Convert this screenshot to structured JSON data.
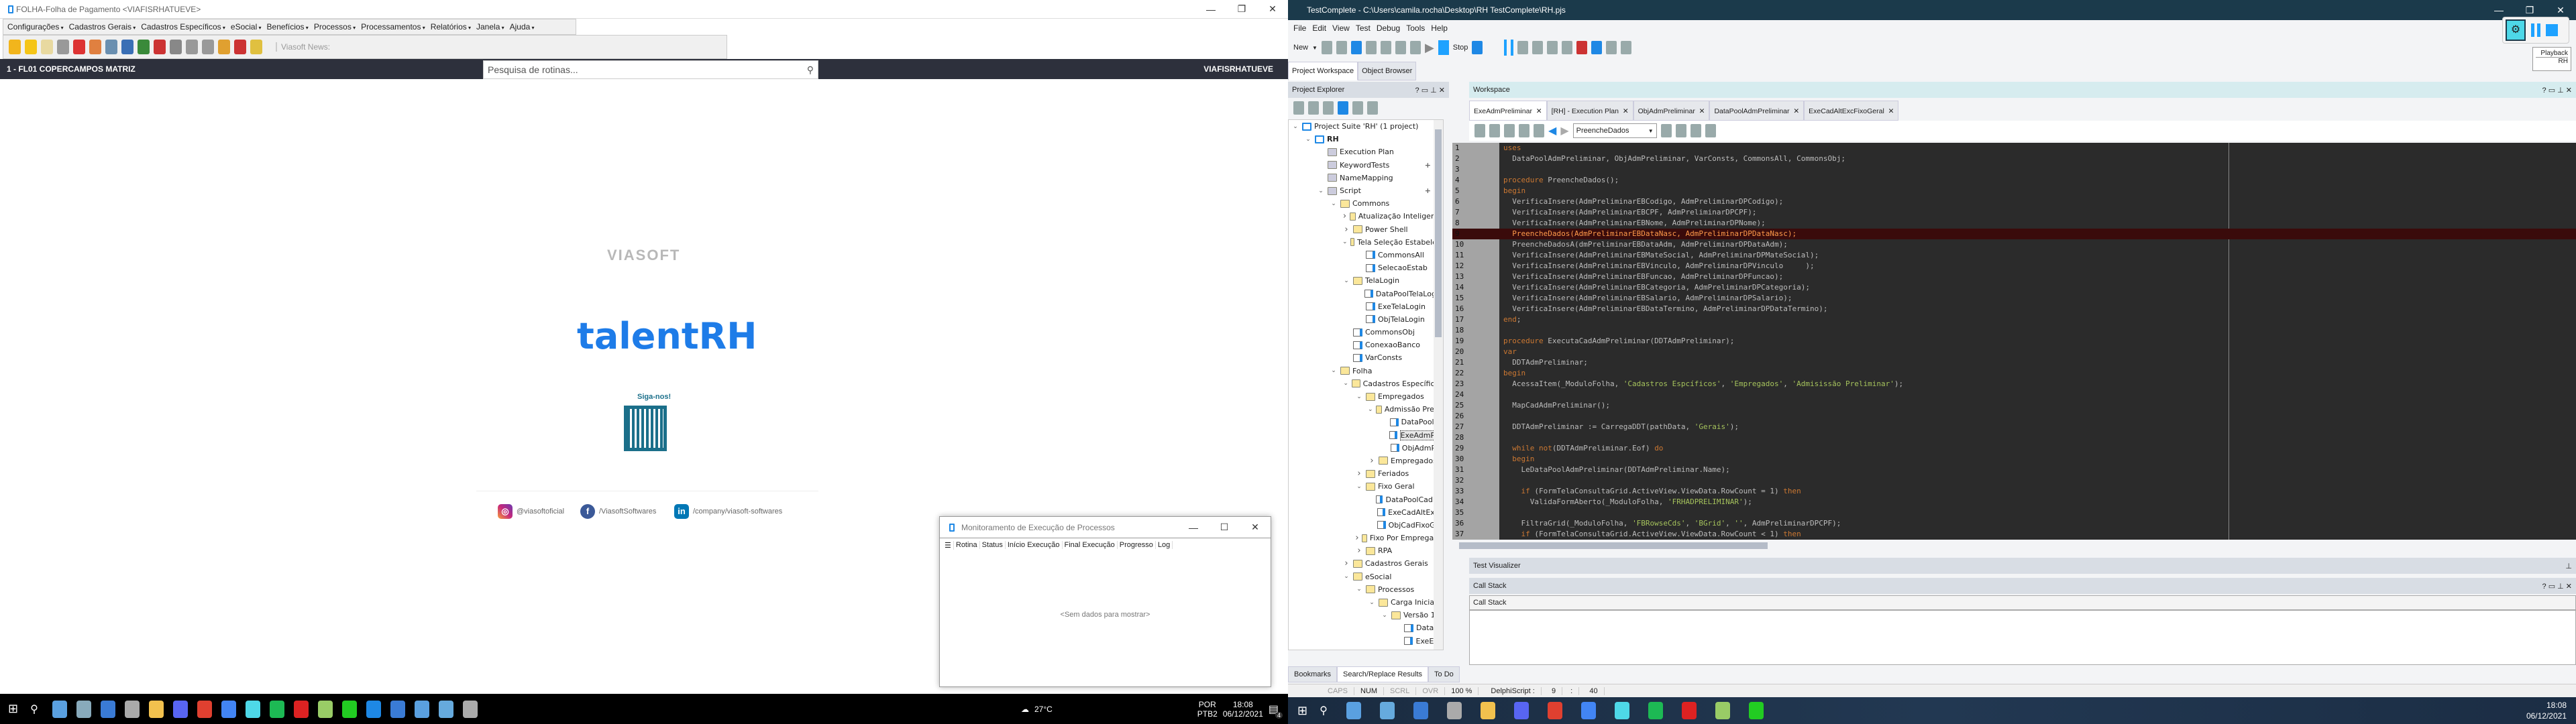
{
  "left_app": {
    "title": "FOLHA-Folha de Pagamento <VIAFISRHATUEVE>",
    "menu": [
      "Configurações",
      "Cadastros Gerais",
      "Cadastros Específicos",
      "eSocial",
      "Benefícios",
      "Processos",
      "Processamentos",
      "Relatórios",
      "Janela",
      "Ajuda"
    ],
    "toolbar_icons": [
      "exit-door",
      "favorite-star",
      "search-doc",
      "copy-docs",
      "home-refresh",
      "user-refresh",
      "calculator",
      "monitor-lock",
      "add-user",
      "add-worker",
      "gear-go",
      "gear-15",
      "gear-30",
      "gear-calendar",
      "gear-down",
      "document-money"
    ],
    "news_label": "Viasoft News:",
    "company": "1 - FL01 COPERCAMPOS MATRIZ",
    "search_placeholder": "Pesquisa de rotinas...",
    "user": "VIAFISRHATUEVE",
    "brand": "VIASOFT",
    "product": "talentRH",
    "follow": "Siga-nos!",
    "social": [
      {
        "icon": "instagram",
        "label": "@viasoftoficial"
      },
      {
        "icon": "facebook",
        "label": "/ViasoftSoftwares"
      },
      {
        "icon": "linkedin",
        "label": "/company/viasoft-softwares"
      }
    ]
  },
  "dialog": {
    "title": "Monitoramento de Execução de Processos",
    "columns": [
      "Rotina",
      "Status",
      "Início Execução",
      "Final Execução",
      "Progresso",
      "Log"
    ],
    "empty": "<Sem dados para mostrar>"
  },
  "left_taskbar": {
    "weather": "27°C",
    "lang1": "POR",
    "lang2": "PTB2",
    "time": "18:08",
    "date": "06/12/2021",
    "notifications": "4"
  },
  "right_app": {
    "title": "TestComplete - C:\\Users\\camila.rocha\\Desktop\\RH TestComplete\\RH.pjs",
    "menu": [
      "File",
      "Edit",
      "View",
      "Test",
      "Debug",
      "Tools",
      "Help"
    ],
    "new_label": "New",
    "stop_label": "Stop",
    "tabs": [
      "Project Workspace",
      "Object Browser"
    ],
    "explorer_title": "Project Explorer",
    "workspace_title": "Workspace",
    "panel_controls": "? ▭ ⊥ ✕",
    "tree": [
      {
        "d": 0,
        "e": "open",
        "i": "proj",
        "l": "Project Suite 'RH' (1 project)"
      },
      {
        "d": 1,
        "e": "open",
        "i": "proj",
        "l": "RH",
        "b": true
      },
      {
        "d": 2,
        "e": "",
        "i": "misc",
        "l": "Execution Plan"
      },
      {
        "d": 2,
        "e": "",
        "i": "misc",
        "l": "KeywordTests",
        "p": true
      },
      {
        "d": 2,
        "e": "",
        "i": "misc",
        "l": "NameMapping"
      },
      {
        "d": 2,
        "e": "open",
        "i": "misc",
        "l": "Script",
        "p": true
      },
      {
        "d": 3,
        "e": "open",
        "i": "folder",
        "l": "Commons"
      },
      {
        "d": 4,
        "e": "closed",
        "i": "folder",
        "l": "Atualização Inteligente"
      },
      {
        "d": 4,
        "e": "closed",
        "i": "folder",
        "l": "Power Shell"
      },
      {
        "d": 4,
        "e": "open",
        "i": "folder",
        "l": "Tela Seleção Estabeleci"
      },
      {
        "d": 5,
        "e": "",
        "i": "script",
        "l": "CommonsAll"
      },
      {
        "d": 5,
        "e": "",
        "i": "script",
        "l": "SelecaoEstab"
      },
      {
        "d": 4,
        "e": "open",
        "i": "folder",
        "l": "TelaLogin"
      },
      {
        "d": 5,
        "e": "",
        "i": "script",
        "l": "DataPoolTelaLogin"
      },
      {
        "d": 5,
        "e": "",
        "i": "script",
        "l": "ExeTelaLogin"
      },
      {
        "d": 5,
        "e": "",
        "i": "script",
        "l": "ObjTelaLogin"
      },
      {
        "d": 4,
        "e": "",
        "i": "script",
        "l": "CommonsObj"
      },
      {
        "d": 4,
        "e": "",
        "i": "script",
        "l": "ConexaoBanco"
      },
      {
        "d": 4,
        "e": "",
        "i": "script",
        "l": "VarConsts"
      },
      {
        "d": 3,
        "e": "open",
        "i": "folder",
        "l": "Folha"
      },
      {
        "d": 4,
        "e": "open",
        "i": "folder",
        "l": "Cadastros Específicos"
      },
      {
        "d": 5,
        "e": "open",
        "i": "folder",
        "l": "Empregados"
      },
      {
        "d": 6,
        "e": "open",
        "i": "folder",
        "l": "Admissão Prelin"
      },
      {
        "d": 7,
        "e": "",
        "i": "script",
        "l": "DataPoolAc"
      },
      {
        "d": 7,
        "e": "",
        "i": "script",
        "l": "ExeAdmPre",
        "sel": true
      },
      {
        "d": 7,
        "e": "",
        "i": "script",
        "l": "ObjAdmPre"
      },
      {
        "d": 6,
        "e": "closed",
        "i": "folder",
        "l": "Empregados"
      },
      {
        "d": 5,
        "e": "closed",
        "i": "folder",
        "l": "Feriados"
      },
      {
        "d": 5,
        "e": "open",
        "i": "folder",
        "l": "Fixo Geral"
      },
      {
        "d": 6,
        "e": "",
        "i": "script",
        "l": "DataPoolCadFix"
      },
      {
        "d": 6,
        "e": "",
        "i": "script",
        "l": "ExeCadAltExcF"
      },
      {
        "d": 6,
        "e": "",
        "i": "script",
        "l": "ObjCadFixoGer"
      },
      {
        "d": 5,
        "e": "closed",
        "i": "folder",
        "l": "Fixo Por Empregado"
      },
      {
        "d": 5,
        "e": "closed",
        "i": "folder",
        "l": "RPA"
      },
      {
        "d": 4,
        "e": "closed",
        "i": "folder",
        "l": "Cadastros Gerais"
      },
      {
        "d": 4,
        "e": "open",
        "i": "folder",
        "l": "eSocial"
      },
      {
        "d": 5,
        "e": "open",
        "i": "folder",
        "l": "Processos"
      },
      {
        "d": 6,
        "e": "open",
        "i": "folder",
        "l": "Carga Inicial"
      },
      {
        "d": 7,
        "e": "open",
        "i": "folder",
        "l": "Versão 1.0"
      },
      {
        "d": 8,
        "e": "",
        "i": "script",
        "l": "DataPo"
      },
      {
        "d": 8,
        "e": "",
        "i": "script",
        "l": "ExeESo"
      },
      {
        "d": 8,
        "e": "",
        "i": "script",
        "l": "ObjESo"
      }
    ],
    "editor_tabs": [
      {
        "l": "ExeAdmPreliminar",
        "a": true
      },
      {
        "l": "[RH] - Execution Plan"
      },
      {
        "l": "ObjAdmPreliminar"
      },
      {
        "l": "DataPoolAdmPreliminar"
      },
      {
        "l": "ExeCadAltExcFixoGeral"
      }
    ],
    "routine_select": "PreencheDados",
    "code": [
      {
        "t": [
          [
            "k",
            "uses"
          ]
        ]
      },
      {
        "t": [
          [
            "t",
            "  DataPoolAdmPreliminar, ObjAdmPreliminar, VarConsts, CommonsAll, CommonsObj;"
          ]
        ]
      },
      {
        "t": []
      },
      {
        "t": [
          [
            "k",
            "procedure"
          ],
          [
            "t",
            " PreencheDados();"
          ]
        ]
      },
      {
        "t": [
          [
            "k",
            "begin"
          ]
        ]
      },
      {
        "t": [
          [
            "t",
            "  VerificaInsere(AdmPreliminarEBCodigo, AdmPreliminarDPCodigo);"
          ]
        ]
      },
      {
        "t": [
          [
            "t",
            "  VerificaInsere(AdmPreliminarEBCPF, AdmPreliminarDPCPF);"
          ]
        ]
      },
      {
        "t": [
          [
            "t",
            "  VerificaInsere(AdmPreliminarEBNome, AdmPreliminarDPNome);"
          ]
        ]
      },
      {
        "t": [
          [
            "t",
            "  PreencheDados(AdmPreliminarEBDataNasc, AdmPreliminarDPDataNasc);"
          ]
        ],
        "hl": true
      },
      {
        "t": [
          [
            "t",
            "  PreencheDadosA(dmPreliminarEBDataAdm, AdmPreliminarDPDataAdm);"
          ]
        ]
      },
      {
        "t": [
          [
            "t",
            "  VerificaInsere(AdmPreliminarEBMateSocial, AdmPreliminarDPMateSocial);"
          ]
        ]
      },
      {
        "t": [
          [
            "t",
            "  VerificaInsere(AdmPreliminarEBVinculo, AdmPreliminarDPVinculo     );"
          ]
        ]
      },
      {
        "t": [
          [
            "t",
            "  VerificaInsere(AdmPreliminarEBFuncao, AdmPreliminarDPFuncao);"
          ]
        ]
      },
      {
        "t": [
          [
            "t",
            "  VerificaInsere(AdmPreliminarEBCategoria, AdmPreliminarDPCategoria);"
          ]
        ]
      },
      {
        "t": [
          [
            "t",
            "  VerificaInsere(AdmPreliminarEBSalario, AdmPreliminarDPSalario);"
          ]
        ]
      },
      {
        "t": [
          [
            "t",
            "  VerificaInsere(AdmPreliminarEBDataTermino, AdmPreliminarDPDataTermino);"
          ]
        ]
      },
      {
        "t": [
          [
            "k",
            "end"
          ],
          [
            "t",
            ";"
          ]
        ]
      },
      {
        "t": []
      },
      {
        "t": [
          [
            "k",
            "procedure"
          ],
          [
            "t",
            " ExecutaCadAdmPreliminar(DDTAdmPreliminar);"
          ]
        ]
      },
      {
        "t": [
          [
            "k",
            "var"
          ]
        ]
      },
      {
        "t": [
          [
            "t",
            "  DDTAdmPreliminar;"
          ]
        ]
      },
      {
        "t": [
          [
            "k",
            "begin"
          ]
        ]
      },
      {
        "t": [
          [
            "t",
            "  AcessaItem(_ModuloFolha, "
          ],
          [
            "s",
            "'Cadastros Espcíficos'"
          ],
          [
            "t",
            ", "
          ],
          [
            "s",
            "'Empregados'"
          ],
          [
            "t",
            ", "
          ],
          [
            "s",
            "'Admisissão Preliminar'"
          ],
          [
            "t",
            ");"
          ]
        ]
      },
      {
        "t": []
      },
      {
        "t": [
          [
            "t",
            "  MapCadAdmPreliminar();"
          ]
        ]
      },
      {
        "t": []
      },
      {
        "t": [
          [
            "t",
            "  DDTAdmPreliminar := CarregaDDT(pathData, "
          ],
          [
            "s",
            "'Gerais'"
          ],
          [
            "t",
            ");"
          ]
        ]
      },
      {
        "t": []
      },
      {
        "t": [
          [
            "t",
            "  "
          ],
          [
            "k",
            "while not"
          ],
          [
            "t",
            "(DDTAdmPreliminar.Eof) "
          ],
          [
            "k",
            "do"
          ]
        ]
      },
      {
        "t": [
          [
            "t",
            "  "
          ],
          [
            "k",
            "begin"
          ]
        ]
      },
      {
        "t": [
          [
            "t",
            "    LeDataPoolAdmPreliminar(DDTAdmPreliminar.Name);"
          ]
        ]
      },
      {
        "t": []
      },
      {
        "t": [
          [
            "t",
            "    "
          ],
          [
            "k",
            "if"
          ],
          [
            "t",
            " (FormTelaConsultaGrid.ActiveView.ViewData.RowCount = 1) "
          ],
          [
            "k",
            "then"
          ]
        ]
      },
      {
        "t": [
          [
            "t",
            "      ValidaFormAberto(_ModuloFolha, "
          ],
          [
            "s",
            "'FRHADPRELIMINAR'"
          ],
          [
            "t",
            ");"
          ]
        ]
      },
      {
        "t": []
      },
      {
        "t": [
          [
            "t",
            "    FiltraGrid(_ModuloFolha, "
          ],
          [
            "s",
            "'FBRowseCds'"
          ],
          [
            "t",
            ", "
          ],
          [
            "s",
            "'BGrid'"
          ],
          [
            "t",
            ", "
          ],
          [
            "s",
            "''"
          ],
          [
            "t",
            ", AdmPreliminarDPCPF);"
          ]
        ]
      },
      {
        "t": [
          [
            "t",
            "    "
          ],
          [
            "k",
            "if"
          ],
          [
            "t",
            " (FormTelaConsultaGrid.ActiveView.ViewData.RowCount < 1) "
          ],
          [
            "k",
            "then"
          ]
        ]
      }
    ],
    "test_visualizer": "Test Visualizer",
    "call_stack": "Call Stack",
    "call_stack_col": "Call Stack",
    "bottom_tabs": [
      "Bookmarks",
      "Search/Replace Results",
      "To Do"
    ],
    "status": {
      "caps": "CAPS",
      "num": "NUM",
      "scrl": "SCRL",
      "ovr": "OVR",
      "zoom": "100 %",
      "lang": "DelphiScript :",
      "line": "9",
      "sep": ":",
      "col": "40"
    },
    "playback_tip": {
      "title": "Playback",
      "project": "RH"
    }
  },
  "right_taskbar": {
    "time": "18:08",
    "date": "06/12/2021"
  },
  "colors": {
    "accent_blue": "#1e88e5",
    "brand_blue": "#1e7ce8",
    "tc_titlebar": "#1b3a4b",
    "code_bg": "#2b2b2b",
    "keyword": "#cc7832",
    "string": "#a5c25c"
  }
}
